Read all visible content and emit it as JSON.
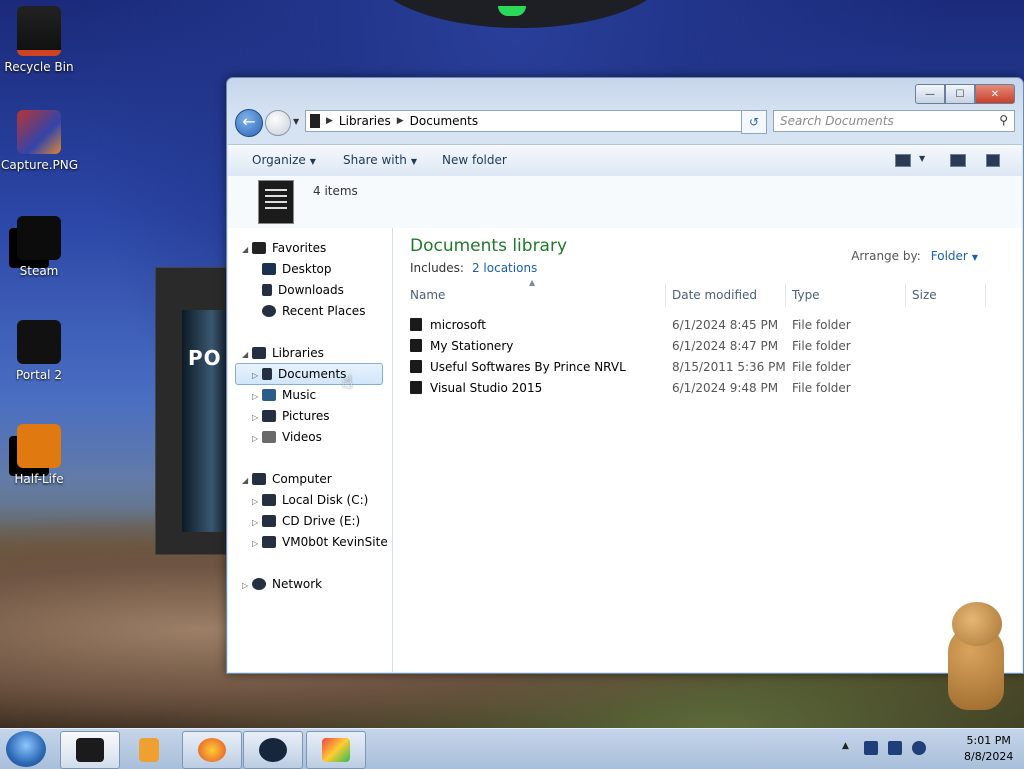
{
  "desktop": {
    "icons": [
      {
        "label": "Recycle Bin",
        "icon": "recycle-bin-icon"
      },
      {
        "label": "Capture.PNG",
        "icon": "image-file-icon"
      },
      {
        "label": "Steam",
        "icon": "steam-icon"
      },
      {
        "label": "Portal 2",
        "icon": "portal2-icon"
      },
      {
        "label": "Half-Life",
        "icon": "half-life-icon"
      }
    ],
    "background_window_text": "PO"
  },
  "explorer": {
    "caption": {
      "minimize": "—",
      "maximize": "☐",
      "close": "✕"
    },
    "address": {
      "crumbs": [
        "Libraries",
        "Documents"
      ]
    },
    "search": {
      "placeholder": "Search Documents"
    },
    "toolbar": {
      "organize": "Organize",
      "share_with": "Share with",
      "new_folder": "New folder"
    },
    "details": {
      "count": "4 items"
    },
    "nav": {
      "favorites": "Favorites",
      "desktop": "Desktop",
      "downloads": "Downloads",
      "recent_places": "Recent Places",
      "libraries": "Libraries",
      "documents": "Documents",
      "music": "Music",
      "pictures": "Pictures",
      "videos": "Videos",
      "computer": "Computer",
      "local_disk": "Local Disk (C:)",
      "cd_drive": "CD Drive (E:)",
      "vm_share": "VM0b0t KevinSite",
      "network": "Network"
    },
    "library": {
      "title": "Documents library",
      "includes_label": "Includes:",
      "locations": "2 locations",
      "arrange_label": "Arrange by:",
      "arrange_value": "Folder"
    },
    "columns": {
      "name": "Name",
      "date": "Date modified",
      "type": "Type",
      "size": "Size"
    },
    "files": [
      {
        "name": "microsoft",
        "date": "6/1/2024 8:45 PM",
        "type": "File folder"
      },
      {
        "name": "My Stationery",
        "date": "6/1/2024 8:47 PM",
        "type": "File folder"
      },
      {
        "name": "Useful Softwares By Prince NRVL",
        "date": "8/15/2011 5:36 PM",
        "type": "File folder"
      },
      {
        "name": "Visual Studio 2015",
        "date": "6/1/2024 9:48 PM",
        "type": "File folder"
      }
    ]
  },
  "taskbar": {
    "clock_time": "5:01 PM",
    "clock_date": "8/8/2024"
  },
  "colors": {
    "library_title": "#1e7a2a",
    "link": "#1a5fb4"
  }
}
